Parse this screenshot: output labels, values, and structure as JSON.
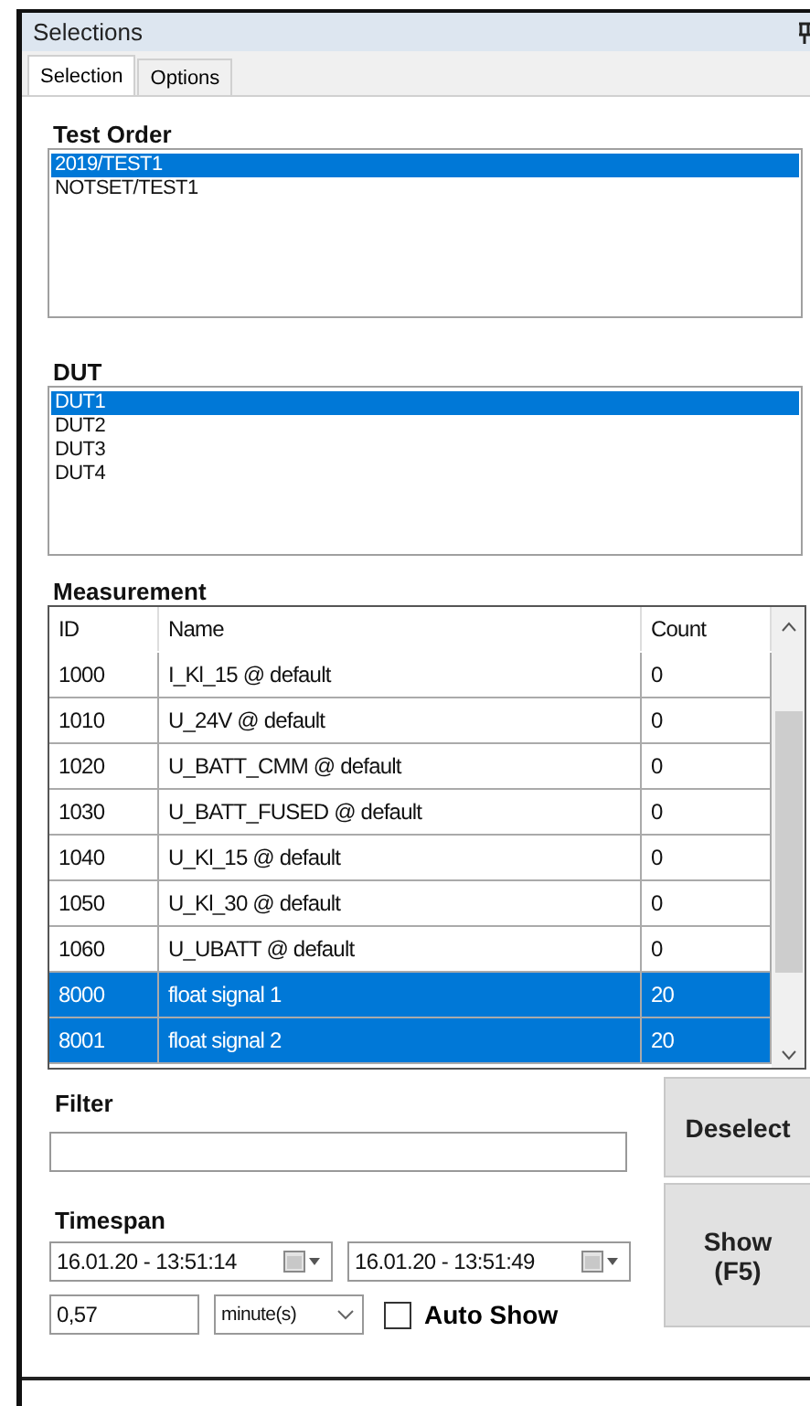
{
  "window": {
    "title": "Selections"
  },
  "tabs": [
    {
      "label": "Selection",
      "selected": true
    },
    {
      "label": "Options",
      "selected": false
    }
  ],
  "test_order": {
    "label": "Test Order",
    "items": [
      {
        "text": "2019/TEST1",
        "selected": true
      },
      {
        "text": "NOTSET/TEST1",
        "selected": false
      }
    ]
  },
  "dut": {
    "label": "DUT",
    "items": [
      {
        "text": "DUT1",
        "selected": true
      },
      {
        "text": "DUT2",
        "selected": false
      },
      {
        "text": "DUT3",
        "selected": false
      },
      {
        "text": "DUT4",
        "selected": false
      }
    ]
  },
  "measurement": {
    "label": "Measurement",
    "columns": [
      "ID",
      "Name",
      "Count"
    ],
    "rows": [
      {
        "cells": [
          "1000",
          "I_Kl_15 @ default",
          "0"
        ],
        "selected": false
      },
      {
        "cells": [
          "1010",
          "U_24V @ default",
          "0"
        ],
        "selected": false
      },
      {
        "cells": [
          "1020",
          "U_BATT_CMM @ default",
          "0"
        ],
        "selected": false
      },
      {
        "cells": [
          "1030",
          "U_BATT_FUSED @ default",
          "0"
        ],
        "selected": false
      },
      {
        "cells": [
          "1040",
          "U_Kl_15 @ default",
          "0"
        ],
        "selected": false
      },
      {
        "cells": [
          "1050",
          "U_Kl_30 @ default",
          "0"
        ],
        "selected": false
      },
      {
        "cells": [
          "1060",
          "U_UBATT @ default",
          "0"
        ],
        "selected": false
      },
      {
        "cells": [
          "8000",
          "float signal 1",
          "20"
        ],
        "selected": true
      },
      {
        "cells": [
          "8001",
          "float signal 2",
          "20"
        ],
        "selected": true
      }
    ]
  },
  "filter": {
    "label": "Filter"
  },
  "deselect_button": "Deselect",
  "timespan": {
    "label": "Timespan",
    "from": "16.01.20 - 13:51:14",
    "to": "16.01.20 - 13:51:49",
    "amount": "0,57",
    "unit": "minute(s)",
    "auto_show": {
      "label": "Auto Show",
      "checked": false
    }
  },
  "show_button": {
    "line1": "Show",
    "line2": "(F5)"
  }
}
